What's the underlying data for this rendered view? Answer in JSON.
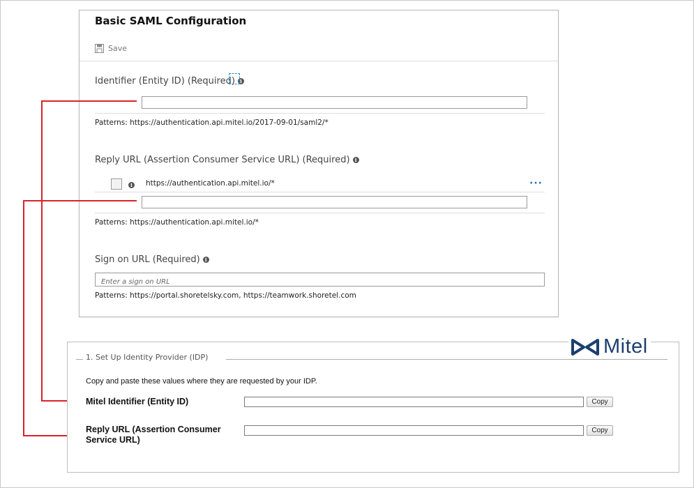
{
  "azure": {
    "title": "Basic SAML Configuration",
    "save_label": "Save",
    "identifier": {
      "label": "Identifier (Entity ID) (Required)",
      "value": "",
      "pattern": "Patterns: https://authentication.api.mitel.io/2017-09-01/saml2/*"
    },
    "reply_url": {
      "label": "Reply URL (Assertion Consumer Service URL) (Required)",
      "existing_value": "https://authentication.api.mitel.io/*",
      "new_value": "",
      "pattern": "Patterns: https://authentication.api.mitel.io/*"
    },
    "sign_on": {
      "label": "Sign on URL (Required)",
      "placeholder": "Enter a sign on URL",
      "pattern": "Patterns: https://portal.shoretelsky.com, https://teamwork.shoretel.com"
    }
  },
  "mitel": {
    "logo_text": "Mitel",
    "section_title": "1. Set Up Identity Provider (IDP)",
    "instructions": "Copy and paste these values where they are requested by your IDP.",
    "identifier_label": "Mitel Identifier (Entity ID)",
    "reply_label_line1": "Reply URL (Assertion Consumer",
    "reply_label_line2": "Service URL)",
    "copy_label": "Copy"
  },
  "colors": {
    "connector": "#d8232a",
    "mitel_brand": "#1c3f6e",
    "info_link": "#2a6fc9"
  }
}
